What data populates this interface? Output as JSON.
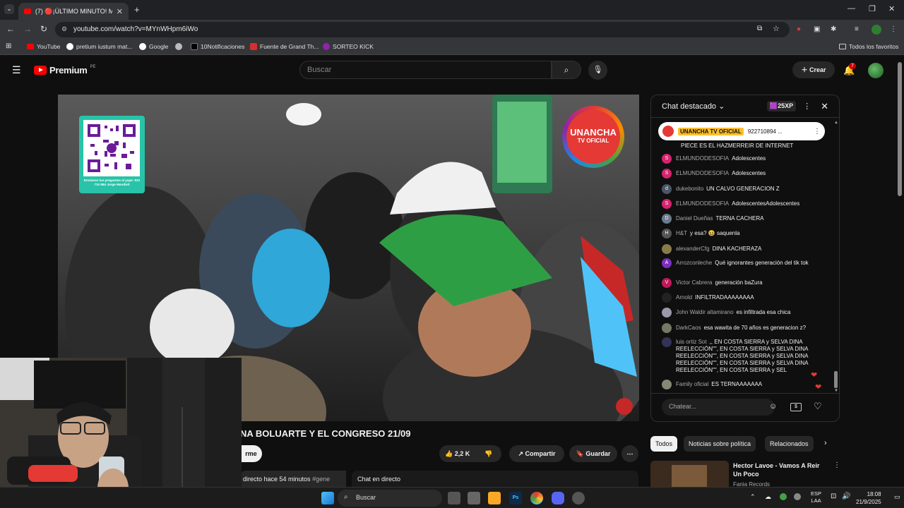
{
  "browser": {
    "tab_title": "(7) 🔴¡ÚLTIMO MINUTO! M",
    "url": "youtube.com/watch?v=MYnWHpm6iWo",
    "bookmarks": [
      "YouTube",
      "pretium iustum mat...",
      "Google",
      "",
      "10Notificaciones",
      "Fuente de Grand Th...",
      "SORTEO KICK"
    ],
    "all_favorites": "Todos los favoritos"
  },
  "youtube": {
    "logo_text": "Premium",
    "region": "PE",
    "search_placeholder": "Buscar",
    "create_label": "Crear",
    "notif_count": "7"
  },
  "video": {
    "qr_caption": "Envíanos tus preguntas al yape: 922 710 894 Jorge Mendivil",
    "brand_badge_line1": "UNANCHA",
    "brand_badge_line2": "TV OFICIAL",
    "title_visible": "NA BOLUARTE Y EL CONGRESO 21/09",
    "likes": "2,2 K",
    "share_label": "Compartir",
    "save_label": "Guardar",
    "subscribe_partial": "rme",
    "live_info": "directo hace 54 minutos",
    "hashtag": "#gene",
    "chat_in_live": "Chat en directo"
  },
  "chat": {
    "header_label": "Chat destacado",
    "xp_badge": "25XP",
    "pinned_channel": "UNANCHA TV OFICIAL",
    "pinned_text": "922710894 ...",
    "first_line": "PIECE ES EL HAZMERREIR DE INTERNET",
    "messages": [
      {
        "initial": "S",
        "author": "ELMUNDODESOFIA",
        "text": "Adolescentes",
        "color": "#d6246e"
      },
      {
        "initial": "S",
        "author": "ELMUNDODESOFIA",
        "text": "Adolescentes",
        "color": "#d6246e"
      },
      {
        "initial": "d",
        "author": "dukebonito",
        "text": "UN CALVO GENERACION Z",
        "color": "#4a5568"
      },
      {
        "initial": "S",
        "author": "ELMUNDODESOFIA",
        "text": "AdolescentesAdolescentes",
        "color": "#d6246e"
      },
      {
        "initial": "D",
        "author": "Daniel Dueñas",
        "text": "TERNA CACHERA",
        "color": "#6b7b8c"
      },
      {
        "initial": "H",
        "author": "H&T",
        "text": "y esa? 😆 saquenla",
        "color": "#555"
      },
      {
        "initial": "",
        "author": "alexanderCfg",
        "text": "DINA KACHERAZA",
        "color": "#8a7b4a"
      },
      {
        "initial": "A",
        "author": "Arrozconleche",
        "text": "Qué ignorantes generación del tik tok",
        "color": "#7b2fbe"
      },
      {
        "initial": "V",
        "author": "Victor Cabrera",
        "text": "generación baZura",
        "color": "#c2185b"
      },
      {
        "initial": "",
        "author": "Arnold",
        "text": "INFILTRADAAAAAAAA",
        "color": "#222"
      },
      {
        "initial": "",
        "author": "John Waldir altamirano",
        "text": "es infiltrada esa chica",
        "color": "#99a"
      },
      {
        "initial": "",
        "author": "DarkCaos",
        "text": "esa wawita de 70 años es generacion z?",
        "color": "#776"
      },
      {
        "initial": "",
        "author": "luis ortiz Sot",
        "text": ",, EN COSTA SIERRA y SELVA DINA REELECCIÓN\"\", EN COSTA SIERRA y SELVA DINA REELECCIÓN\"\", EN COSTA SIERRA y SELVA DINA REELECCIÓN\"\", EN COSTA SIERRA y SELVA DINA REELECCIÓN\"\", EN COSTA SIERRA y SEL",
        "color": "#335"
      },
      {
        "initial": "",
        "author": "Family oficial",
        "text": "ES TERNAAAAAAA",
        "color": "#887"
      }
    ],
    "input_placeholder": "Chatear..."
  },
  "sidebar": {
    "chips": [
      "Todos",
      "Noticias sobre política",
      "Relacionados"
    ],
    "rec_title": "Hector Lavoe - Vamos A Reir Un Poco",
    "rec_channel": "Fania Records"
  },
  "taskbar": {
    "search_label": "Buscar",
    "lang_line1": "ESP",
    "lang_line2": "LAA",
    "time": "18:08",
    "date": "21/9/2025"
  }
}
